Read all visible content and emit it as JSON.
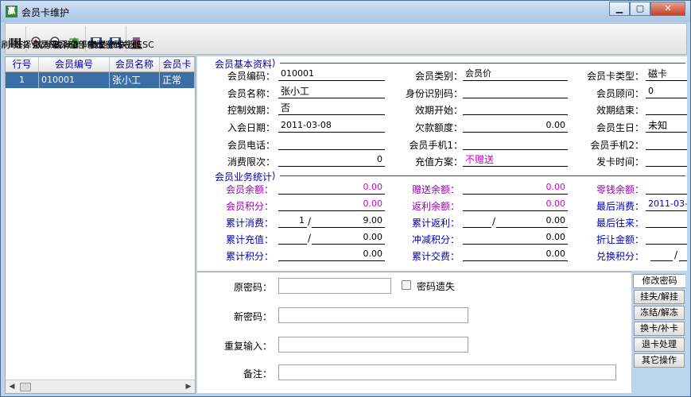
{
  "window": {
    "title": "会员卡维护",
    "app_icon": "贏",
    "min": "0",
    "max": "1",
    "close": "r"
  },
  "toolbar": [
    {
      "name": "swipe-card-button",
      "icon": "barcode-icon",
      "label": "刷卡F2"
    },
    {
      "name": "select-member-button",
      "icon": "zoom-in-icon",
      "label": "选择会员F3"
    },
    {
      "name": "cancel-select-button",
      "icon": "zoom-out-icon",
      "label": "取消选择F5"
    },
    {
      "name": "cancel-all-button",
      "icon": "erase-icon",
      "label": "取消全部F6"
    },
    {
      "name": "single-change-password-button",
      "icon": "floppy-icon",
      "label": "单卡修改密码"
    },
    {
      "name": "batch-change-password-button",
      "icon": "floppy-icon",
      "label": "批量修改密码"
    },
    {
      "name": "close-esc-button",
      "icon": "door-exit-icon",
      "label": "关闭ESC"
    }
  ],
  "grid": {
    "headers": [
      "行号",
      "会员编号",
      "会员名称",
      "会员卡"
    ],
    "rows": [
      [
        "1",
        "010001",
        "张小工",
        "正常"
      ]
    ]
  },
  "basic": {
    "title": "会员基本资料",
    "fields": {
      "code_label": "会员编码：",
      "code": "010001",
      "category_label": "会员类别：",
      "category": "会员价",
      "cardtype_label": "会员卡类型：",
      "cardtype": "磁卡",
      "name_label": "会员名称：",
      "name": "张小工",
      "idcard_label": "身份识别码：",
      "idcard": "",
      "advisor_label": "会员顾问：",
      "advisor": "0",
      "ctrl_label": "控制效期：",
      "ctrl": "否",
      "start_label": "效期开始：",
      "start": "",
      "end_label": "效期结束：",
      "end": "",
      "join_label": "入会日期：",
      "join": "2011-03-08",
      "owe_label": "欠款额度：",
      "owe": "0.00",
      "birthday_label": "会员生日：",
      "birthday": "未知",
      "phone_label": "会员电话：",
      "phone": "",
      "mobile1_label": "会员手机1：",
      "mobile1": "",
      "mobile2_label": "会员手机2：",
      "mobile2": "",
      "limit_label": "消费限次：",
      "limit": "0",
      "recharge_label": "充值方案：",
      "recharge": "不赠送",
      "issue_label": "发卡时间：",
      "issue": ""
    }
  },
  "stats": {
    "title": "会员业务统计",
    "fields": {
      "balance_label": "会员余额：",
      "balance": "0.00",
      "gift_label": "赠送余额：",
      "gift": "0.00",
      "change_label": "零钱余额：",
      "change": "",
      "points_label": "会员积分：",
      "points": "0.00",
      "rebate_label": "返利余额：",
      "rebate": "0.00",
      "last_label": "最后消费：",
      "last": "2011-03-",
      "cumspend_label": "累计消费：",
      "cumspend_a": "1",
      "cumspend_b": "9.00",
      "cumrebate_label": "累计返利：",
      "cumrebate": "0.00",
      "lastdeal_label": "最后往来：",
      "lastdeal": "",
      "cumcharge_label": "累计充值：",
      "cumcharge": "0.00",
      "offset_label": "冲减积分：",
      "offset": "0.00",
      "discount_label": "折让金额：",
      "discount": "",
      "cumpoints_label": "累计积分：",
      "cumpoints": "0.00",
      "cumdeal_label": "累计交费：",
      "cumdeal": "0.00",
      "exchange_label": "兑换积分：",
      "exchange": ""
    }
  },
  "password": {
    "old_label": "原密码：",
    "lost_label": "密码遗失",
    "new_label": "新密码：",
    "repeat_label": "重复输入：",
    "note_label": "备注："
  },
  "tabs": [
    "修改密码",
    "挂失/解挂",
    "冻结/解冻",
    "换卡/补卡",
    "退卡处理",
    "其它操作"
  ]
}
